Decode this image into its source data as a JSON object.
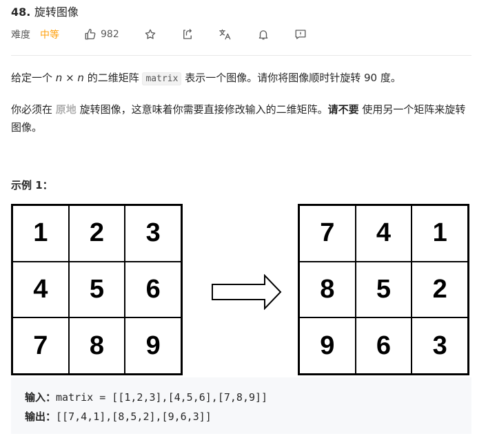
{
  "problem": {
    "number": "48.",
    "name": "旋转图像"
  },
  "meta": {
    "difficulty_label": "难度",
    "difficulty_value": "中等",
    "likes": "982",
    "difficulty_color": "#ff9f0a"
  },
  "icons": [
    "thumbs-up-icon",
    "star-icon",
    "share-icon",
    "translate-icon",
    "bell-icon",
    "feedback-icon"
  ],
  "description": {
    "p1_a": "给定一个 ",
    "p1_n1": "n",
    "p1_x": " × ",
    "p1_n2": "n",
    "p1_b": " 的二维矩阵 ",
    "p1_code": "matrix",
    "p1_c": " 表示一个图像。请你将图像顺时针旋转 90 度。",
    "p2_a": "你必须在 ",
    "p2_inplace": "原地",
    "p2_b": " 旋转图像，这意味着你需要直接修改输入的二维矩阵。",
    "p2_dont": "请不要",
    "p2_c": " 使用另一个矩阵来旋转图像。"
  },
  "example": {
    "title": "示例 1：",
    "input_matrix": [
      "1",
      "2",
      "3",
      "4",
      "5",
      "6",
      "7",
      "8",
      "9"
    ],
    "output_matrix": [
      "7",
      "4",
      "1",
      "8",
      "5",
      "2",
      "9",
      "6",
      "3"
    ],
    "input_label": "输入：",
    "input_value": "matrix = [[1,2,3],[4,5,6],[7,8,9]]",
    "output_label": "输出：",
    "output_value": "[[7,4,1],[8,5,2],[9,6,3]]"
  }
}
